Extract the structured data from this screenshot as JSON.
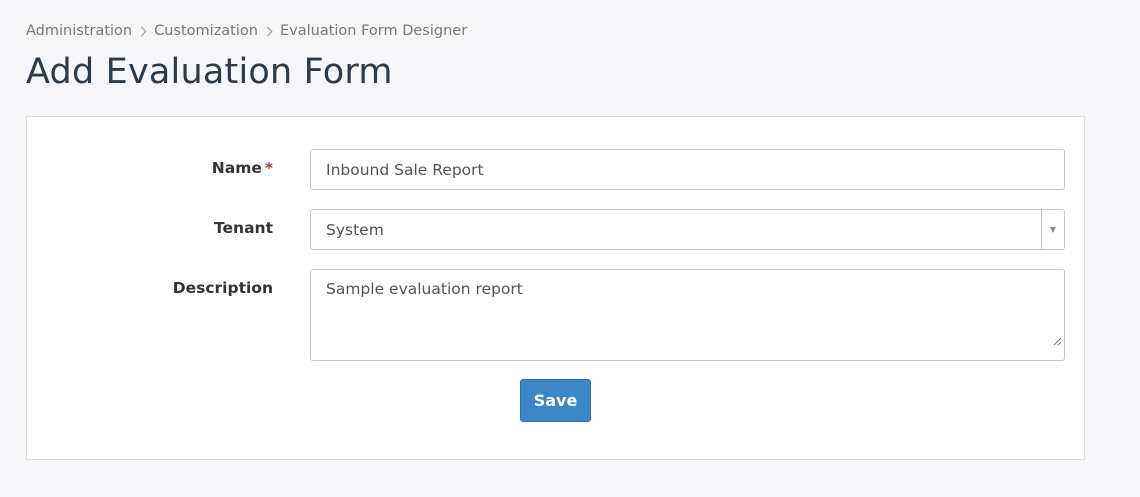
{
  "breadcrumb": {
    "items": [
      "Administration",
      "Customization",
      "Evaluation Form Designer"
    ]
  },
  "page": {
    "title": "Add Evaluation Form"
  },
  "form": {
    "name": {
      "label": "Name",
      "required_mark": "*",
      "value": "Inbound Sale Report"
    },
    "tenant": {
      "label": "Tenant",
      "value": "System"
    },
    "description": {
      "label": "Description",
      "value": "Sample evaluation report"
    },
    "save_label": "Save"
  },
  "colors": {
    "primary_button": "#3b87c8",
    "required_mark": "#c9302c",
    "title": "#2d3a48"
  }
}
